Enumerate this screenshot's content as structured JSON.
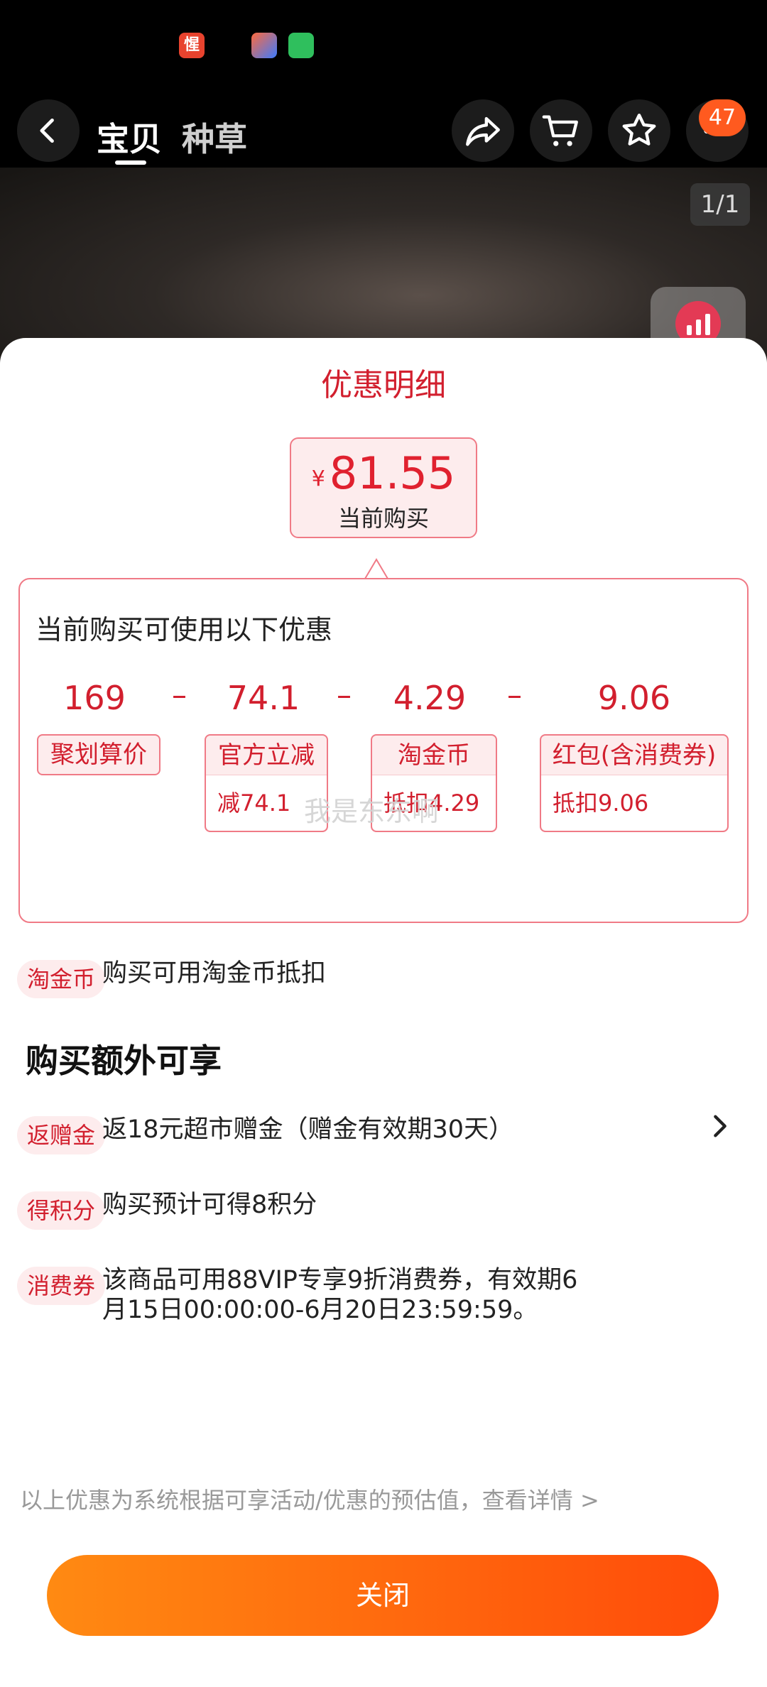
{
  "status_bar": {
    "app_icon_text": "惺"
  },
  "nav": {
    "tabs": [
      "宝贝",
      "种草"
    ],
    "badge_count": "47",
    "icons": [
      "back-icon",
      "share-icon",
      "cart-icon",
      "star-icon",
      "more-icon"
    ]
  },
  "gallery": {
    "pager": "1/1"
  },
  "sheet": {
    "title": "优惠明细",
    "price": {
      "currency": "¥",
      "amount": "81.55",
      "label": "当前购买"
    },
    "panel": {
      "title": "当前购买可使用以下优惠",
      "values": [
        "169",
        "74.1",
        "4.29",
        "9.06"
      ],
      "operator": "–",
      "tags": [
        {
          "head": "聚划算价"
        },
        {
          "head": "官方立减",
          "body": "减74.1"
        },
        {
          "head": "淘金币",
          "body": "抵扣4.29"
        },
        {
          "head": "红包(含消费券)",
          "body": "抵扣9.06"
        }
      ],
      "watermark": "我是东东啊"
    },
    "rows": [
      {
        "tag": "淘金币",
        "text": "购买可用淘金币抵扣"
      }
    ],
    "extra_title": "购买额外可享",
    "extras": [
      {
        "tag": "返赠金",
        "text": "返18元超市赠金（赠金有效期30天）"
      },
      {
        "tag": "得积分",
        "text": "购买预计可得8积分"
      },
      {
        "tag": "消费券",
        "text_line1": "该商品可用88VIP专享9折消费券，有效期6",
        "text_line2": "月15日00:00:00-6月20日23:59:59。"
      }
    ],
    "disclaimer": "以上优惠为系统根据可享活动/优惠的预估值，查看详情 >",
    "close_label": "关闭"
  },
  "colors": {
    "accent": "#d21f2e",
    "button_start": "#ff8a12",
    "button_end": "#ff4b0a"
  }
}
